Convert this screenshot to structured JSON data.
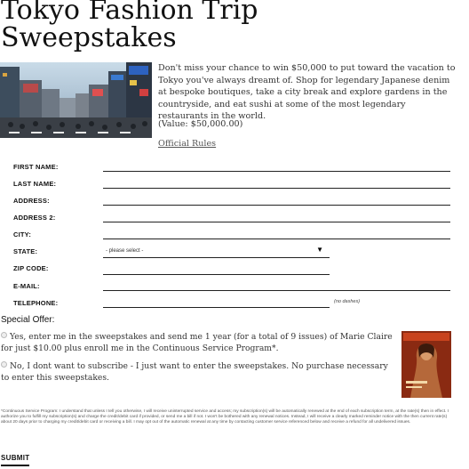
{
  "title": "Tokyo Fashion Trip Sweepstakes",
  "intro": "Don't miss your chance to win $50,000 to put toward the vacation to Tokyo you've always dreamt of. Shop for legendary Japanese denim at bespoke boutiques, take a city break and explore gardens in the countryside, and eat sushi at some of the most legendary restaurants in the world.",
  "value": "(Value: $50,000.00)",
  "official_rules": "Official Rules",
  "form": {
    "first_name": "FIRST NAME:",
    "last_name": "LAST NAME:",
    "address": "ADDRESS:",
    "address2": "ADDRESS 2:",
    "city": "CITY:",
    "state": "STATE:",
    "state_selected": "- please select -",
    "zip": "ZIP CODE:",
    "email": "E-MAIL:",
    "telephone": "TELEPHONE:",
    "phone_hint": "(no dashes)"
  },
  "special_offer": {
    "heading": "Special Offer:",
    "option_yes": "Yes, enter me in the sweepstakes and send me 1 year (for a total of 9 issues) of Marie Claire for just $10.00 plus enroll me in the Continuous Service Program*.",
    "option_no": "No, I dont want to subscribe - I just want to enter the sweepstakes. No purchase necessary to enter this sweepstakes."
  },
  "fine_print": "*Continuous Service Program: I understand that unless I tell you otherwise, I will receive uninterrupted service and access; my subscription(s) will be automatically renewed at the end of each subscription term, at the rate(s) then in effect. I authorize you to fulfill my subscription(s) and charge the credit/debit card if provided, or send me a bill if not. I won't be bothered with any renewal notices. Instead, I will receive a clearly marked reminder notice with the then current rate(s) about 20 days prior to charging my credit/debit card or receiving a bill. I may opt out of the automatic renewal at any time by contacting customer service referenced below and receive a refund for all undelivered issues.",
  "submit": "SUBMIT"
}
